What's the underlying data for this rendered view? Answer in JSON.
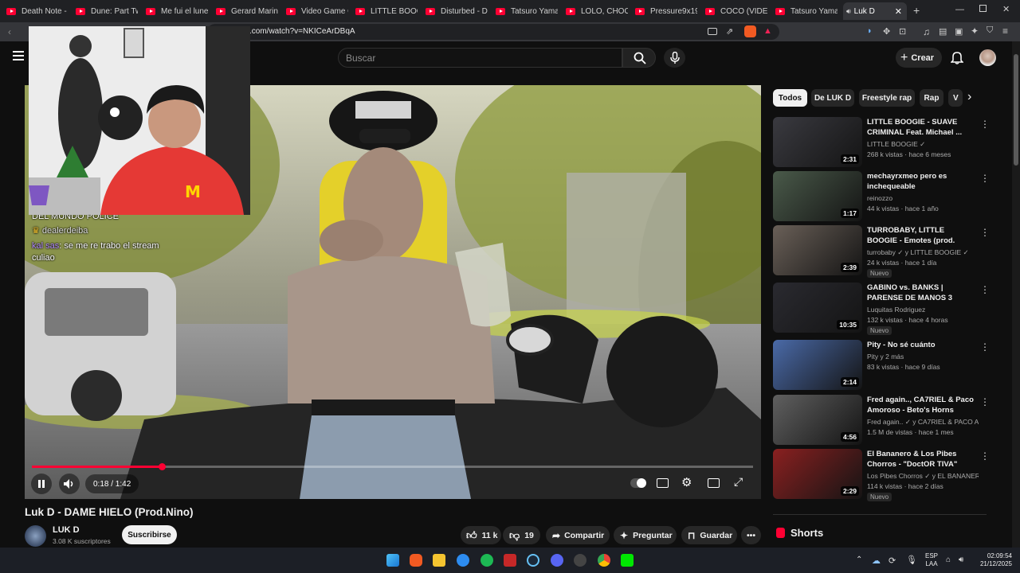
{
  "browser": {
    "tabs": [
      {
        "label": "Death Note - C"
      },
      {
        "label": "Dune: Part Two"
      },
      {
        "label": "Me fui el lunes"
      },
      {
        "label": "Gerard Marino"
      },
      {
        "label": "Video Game Q"
      },
      {
        "label": "LITTLE BOOGIE"
      },
      {
        "label": "Disturbed - Do"
      },
      {
        "label": "Tatsuro Yamash"
      },
      {
        "label": "LOLO, CHOOSE"
      },
      {
        "label": "Pressure9x19 -"
      },
      {
        "label": "COCO (VIDEO C"
      },
      {
        "label": "Tatsuro Yamash"
      },
      {
        "label": "Luk D"
      }
    ],
    "new_tab": "+",
    "url": ".com/watch?v=NKICeArDBqA"
  },
  "header": {
    "search_placeholder": "Buscar",
    "create_label": "Crear"
  },
  "player": {
    "time": "0:18 / 1:42",
    "progress": 0.18,
    "chat": [
      {
        "user": "",
        "text": "DEL MUNDO POLICE"
      },
      {
        "user": "dealerdeiba",
        "text": ""
      },
      {
        "user": "kal sas",
        "text": "se me re trabo el stream culiao"
      }
    ]
  },
  "video_info": {
    "title": "Luk D - DAME HIELO (Prod.Nino)",
    "channel": "LUK D",
    "subscribers": "3.08 K suscriptores",
    "subscribe_label": "Suscribirse",
    "likes": "11 k",
    "dislikes": "19",
    "share_label": "Compartir",
    "ask_label": "Preguntar",
    "save_label": "Guardar"
  },
  "chips": [
    {
      "label": "Todos"
    },
    {
      "label": "De LUK D"
    },
    {
      "label": "Freestyle rap"
    },
    {
      "label": "Rap"
    },
    {
      "label": "V"
    }
  ],
  "recommendations": [
    {
      "title": "LITTLE BOOGIE - SUAVE CRIMINAL Feat. Michael ...",
      "channel": "LITTLE BOOGIE ✓",
      "meta": "268 k vistas · hace 6 meses",
      "duration": "2:31",
      "badge": "",
      "bg": "#3a3a40"
    },
    {
      "title": "mechayrxmeo pero es inchequeable",
      "channel": "reinozzo",
      "meta": "44 k vistas · hace 1 año",
      "duration": "1:17",
      "badge": "",
      "bg": "#4a5a4a"
    },
    {
      "title": "TURROBABY, LITTLE BOOGIE - Emotes (prod. ezeq)",
      "channel": "turrobaby ✓ y LITTLE BOOGIE ✓",
      "meta": "24 k vistas · hace 1 día",
      "duration": "2:39",
      "badge": "Nuevo",
      "bg": "#6a6058"
    },
    {
      "title": "GABINO vs. BANKS | PARENSE DE MANOS 3 #PDM3",
      "channel": "Luquitas Rodriguez",
      "meta": "132 k vistas · hace 4 horas",
      "duration": "10:35",
      "badge": "Nuevo",
      "bg": "#2a2a30"
    },
    {
      "title": "Pity - No sé cuánto",
      "channel": "Pity y 2 más",
      "meta": "83 k vistas · hace 9 días",
      "duration": "2:14",
      "badge": "",
      "bg": "#4a6aa8"
    },
    {
      "title": "Fred again.., CA7RIEL & Paco Amoroso - Beto's Horns (Paris,...",
      "channel": "Fred again.. ✓ y CA7RIEL & PACO AMO...",
      "meta": "1.5 M de vistas · hace 1 mes",
      "duration": "4:56",
      "badge": "",
      "bg": "#606060"
    },
    {
      "title": "El Bananero & Los Pibes Chorros - \"DoctOR TIVA\" (Vide...",
      "channel": "Los Pibes Chorros ✓ y EL BANANERO O...",
      "meta": "114 k vistas · hace 2 días",
      "duration": "2:29",
      "badge": "Nuevo",
      "bg": "#8a2020"
    }
  ],
  "shorts_label": "Shorts",
  "taskbar": {
    "lang": "ESP",
    "layout": "LAA",
    "time": "02:09:54",
    "date": "21/12/2025"
  },
  "colors": {
    "accent": "#ff0033",
    "background": "#0f0f0f",
    "chip": "#272727"
  }
}
